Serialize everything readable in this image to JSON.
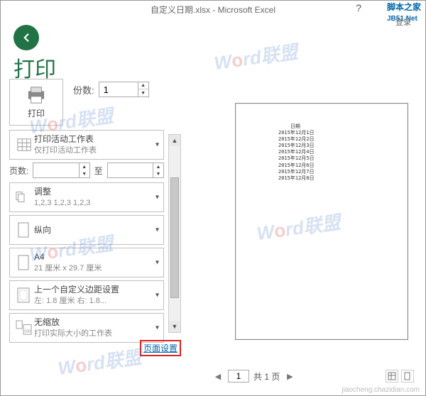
{
  "titlebar": {
    "filename": "自定义日期.xlsx - Microsoft Excel",
    "help": "?",
    "brand": "脚本之家",
    "brand_sub": "JB51.Net",
    "login": "登录"
  },
  "page": {
    "title": "打印"
  },
  "print_button": {
    "label": "打印"
  },
  "copies": {
    "label": "份数:",
    "value": "1"
  },
  "options": {
    "print_active": {
      "l1": "打印活动工作表",
      "l2": "仅打印活动工作表"
    },
    "pages": {
      "label": "页数:",
      "to": "至",
      "from": "",
      "until": ""
    },
    "collate": {
      "l1": "调整",
      "l2": "1,2,3    1,2,3    1,2,3"
    },
    "orientation": {
      "l1": "纵向"
    },
    "paper": {
      "l1": "A4",
      "l2": "21 厘米 x 29.7 厘米"
    },
    "margins": {
      "l1": "上一个自定义边距设置",
      "l2": "左: 1.8 厘米    右: 1.8..."
    },
    "scale": {
      "l1": "无缩放",
      "l2": "打印实际大小的工作表"
    }
  },
  "page_setup_link": "页面设置",
  "preview": {
    "nav": {
      "current": "1",
      "total_label": "共 1 页"
    },
    "content": "    日期\n2015年12月1日\n2015年12月2日\n2015年12月3日\n2015年12月4日\n2015年12月5日\n2015年12月6日\n2015年12月7日\n2015年12月8日"
  },
  "watermark": "Word联盟",
  "footer_credit": "jiaocheng.chazidian.com"
}
